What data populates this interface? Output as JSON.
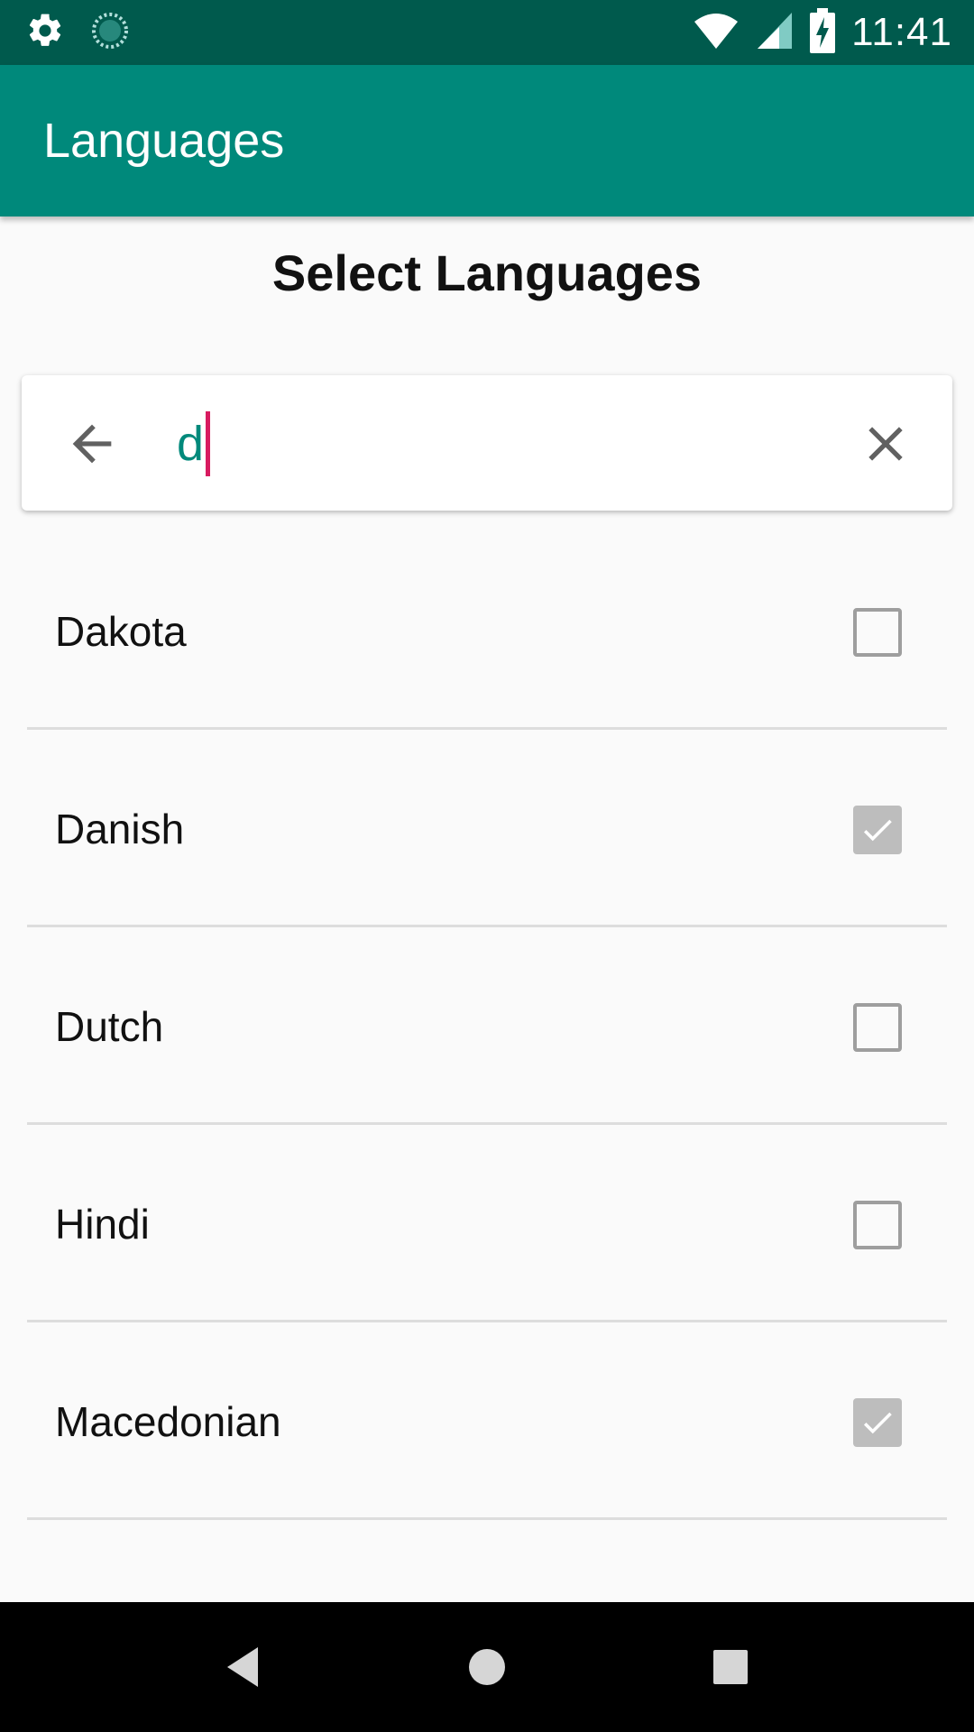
{
  "status_bar": {
    "time": "11:41",
    "left_icons": [
      "settings-icon",
      "loading-icon"
    ],
    "right_icons": [
      "wifi-icon",
      "signal-icon",
      "battery-charging-icon"
    ]
  },
  "app_bar": {
    "title": "Languages"
  },
  "section": {
    "title": "Select Languages"
  },
  "search": {
    "value": "d",
    "back_icon": "arrow-back-icon",
    "clear_icon": "close-icon",
    "text_color": "#00897b",
    "cursor_color": "#d81b60"
  },
  "languages": [
    {
      "label": "Dakota",
      "checked": false
    },
    {
      "label": "Danish",
      "checked": true
    },
    {
      "label": "Dutch",
      "checked": false
    },
    {
      "label": "Hindi",
      "checked": false
    },
    {
      "label": "Macedonian",
      "checked": true
    }
  ],
  "nav_bar": {
    "buttons": [
      "back-icon",
      "home-icon",
      "recents-icon"
    ]
  },
  "colors": {
    "status_bar": "#005a4d",
    "app_bar": "#00897b",
    "checkbox_checked": "#bdbdbd",
    "checkbox_border": "#9e9e9e"
  }
}
